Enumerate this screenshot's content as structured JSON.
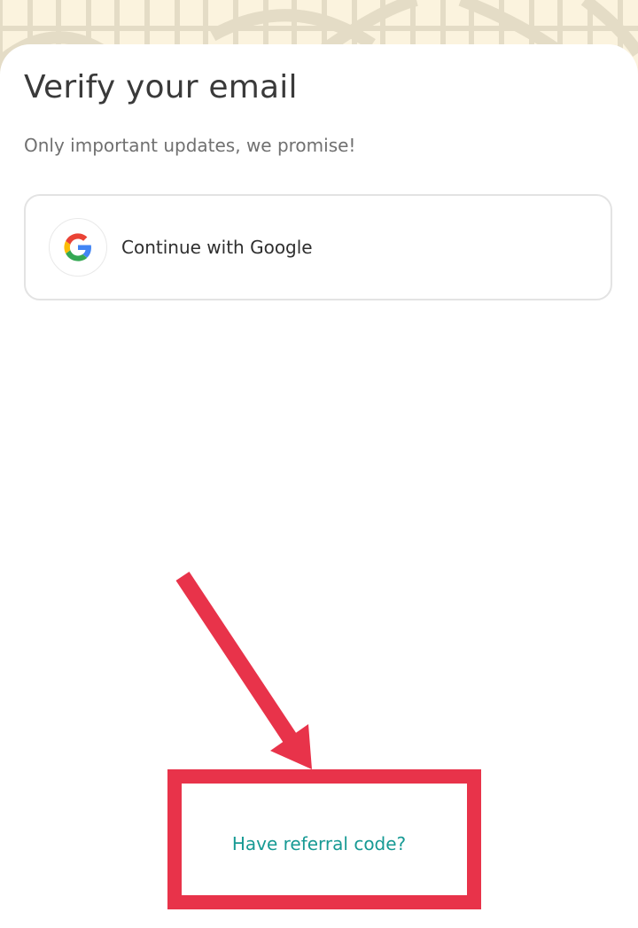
{
  "header": {
    "title": "Verify your email",
    "subtitle": "Only important updates, we promise!"
  },
  "google_button": {
    "label": "Continue with Google",
    "icon": "google-g-icon"
  },
  "referral": {
    "link_label": "Have referral code?"
  },
  "colors": {
    "accent": "#179a94",
    "annotation": "#e8334a",
    "background": "#fdf6e3"
  }
}
